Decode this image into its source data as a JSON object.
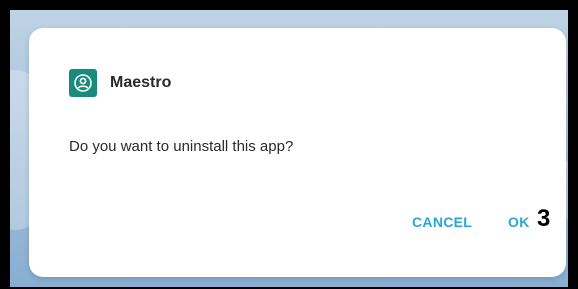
{
  "dialog": {
    "app_name": "Maestro",
    "app_icon": "person-icon",
    "message": "Do you want to uninstall this app?",
    "cancel_label": "CANCEL",
    "ok_label": "OK",
    "marker_label": "3"
  },
  "colors": {
    "accent": "#2aa6d4",
    "app_icon_bg": "#1a8a7c",
    "background": "#aec6de"
  }
}
